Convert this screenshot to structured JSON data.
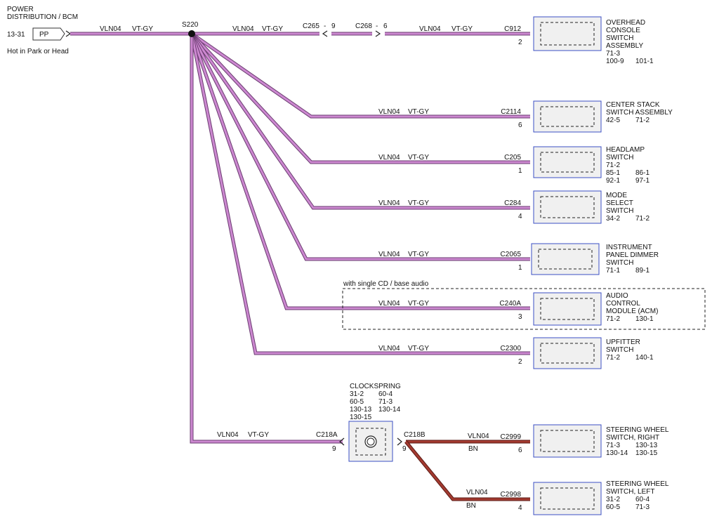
{
  "colors": {
    "vt_gy_fill": "#cc88d0",
    "vt_gy_edge": "#6a3c70",
    "bn_fill": "#a33a30",
    "bn_edge": "#5a1a14",
    "component_border": "#3b4fc4",
    "component_fill": "#f0f0f0"
  },
  "source": {
    "name_lines": [
      "POWER",
      "DISTRIBUTION / BCM"
    ],
    "pin": "13-31",
    "connector": "PP",
    "note": "Hot in Park or Head"
  },
  "splice": {
    "label": "S220"
  },
  "wire_circuit": "VLN04",
  "wire_color_main": "VT-GY",
  "wire_color_bn": "BN",
  "inline_connectors": [
    {
      "label": "C265",
      "sep": "-",
      "pin": "9"
    },
    {
      "label": "C268",
      "sep": "-",
      "pin": "6"
    }
  ],
  "branches": [
    {
      "key": "overhead",
      "connector": "C912",
      "pin": "2",
      "component_lines": [
        "OVERHEAD",
        "CONSOLE",
        "SWITCH",
        "ASSEMBLY"
      ],
      "refs": [
        [
          "71-3"
        ],
        [
          "100-9",
          "101-1"
        ]
      ]
    },
    {
      "key": "centerstack",
      "connector": "C2114",
      "pin": "6",
      "component_lines": [
        "CENTER STACK",
        "SWITCH ASSEMBLY"
      ],
      "refs": [
        [
          "42-5",
          "71-2"
        ]
      ]
    },
    {
      "key": "headlamp",
      "connector": "C205",
      "pin": "1",
      "component_lines": [
        "HEADLAMP",
        "SWITCH"
      ],
      "refs": [
        [
          "71-2"
        ],
        [
          "85-1",
          "86-1"
        ],
        [
          "92-1",
          "97-1"
        ]
      ]
    },
    {
      "key": "mode",
      "connector": "C284",
      "pin": "4",
      "component_lines": [
        "MODE",
        "SELECT",
        "SWITCH"
      ],
      "refs": [
        [
          "34-2",
          "71-2"
        ]
      ]
    },
    {
      "key": "dimmer",
      "connector": "C2065",
      "pin": "1",
      "component_lines": [
        "INSTRUMENT",
        "PANEL DIMMER",
        "SWITCH"
      ],
      "refs": [
        [
          "71-1",
          "89-1"
        ]
      ]
    },
    {
      "key": "acm",
      "connector": "C240A",
      "pin": "3",
      "component_lines": [
        "AUDIO",
        "CONTROL",
        "MODULE (ACM)"
      ],
      "refs": [
        [
          "71-2",
          "130-1"
        ]
      ]
    },
    {
      "key": "upfitter",
      "connector": "C2300",
      "pin": "2",
      "component_lines": [
        "UPFITTER",
        "SWITCH"
      ],
      "refs": [
        [
          "71-2",
          "140-1"
        ]
      ]
    },
    {
      "key": "swright",
      "connector": "C2999",
      "pin": "6",
      "component_lines": [
        "STEERING WHEEL",
        "SWITCH, RIGHT"
      ],
      "refs": [
        [
          "71-3",
          "130-13"
        ],
        [
          "130-14",
          "130-15"
        ]
      ]
    },
    {
      "key": "swleft",
      "connector": "C2998",
      "pin": "4",
      "component_lines": [
        "STEERING WHEEL",
        "SWITCH, LEFT"
      ],
      "refs": [
        [
          "31-2",
          "60-4"
        ],
        [
          "60-5",
          "71-3"
        ]
      ]
    }
  ],
  "option_box": {
    "label": "with single CD / base audio"
  },
  "clockspring": {
    "title": "CLOCKSPRING",
    "refs": [
      [
        "31-2",
        "60-4"
      ],
      [
        "60-5",
        "71-3"
      ],
      [
        "130-13",
        "130-14"
      ],
      [
        "130-15"
      ]
    ],
    "in_connector": "C218A",
    "in_pin": "9",
    "out_connector": "C218B",
    "out_pin": "9"
  }
}
